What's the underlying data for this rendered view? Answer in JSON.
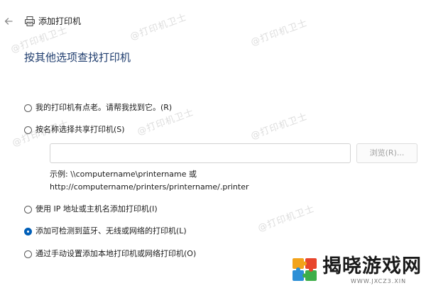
{
  "window": {
    "title": "添加打印机"
  },
  "heading": "按其他选项查找打印机",
  "options": [
    {
      "label": "我的打印机有点老。请帮我找到它。(R)",
      "checked": false
    },
    {
      "label": "按名称选择共享打印机(S)",
      "checked": false
    },
    {
      "label": "使用 IP 地址或主机名添加打印机(I)",
      "checked": false
    },
    {
      "label": "添加可检测到蓝牙、无线或网络的打印机(L)",
      "checked": true
    },
    {
      "label": "通过手动设置添加本地打印机或网络打印机(O)",
      "checked": false
    }
  ],
  "shared": {
    "input_value": "",
    "browse_label": "浏览(R)...",
    "example_line1": "示例: \\\\computername\\printername 或",
    "example_line2": "http://computername/printers/printername/.printer"
  },
  "watermark": {
    "text": "@打印机卫士"
  },
  "brand": {
    "name": "揭晓游戏网",
    "url": "WWW.JXCZ3.XIN"
  },
  "colors": {
    "accent": "#005fb8",
    "heading": "#1f3d6e"
  }
}
